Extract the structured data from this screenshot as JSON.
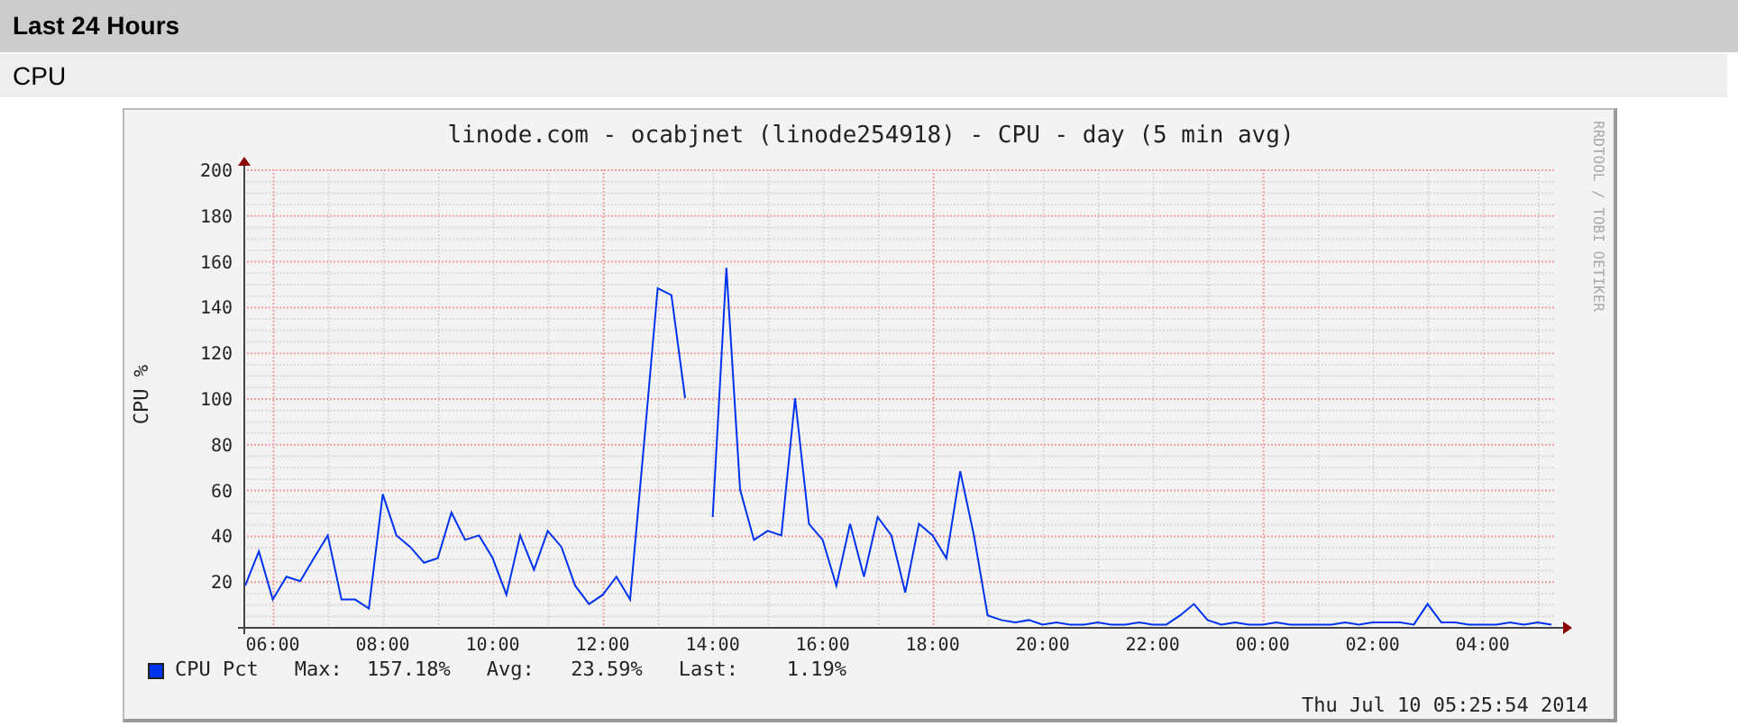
{
  "section": {
    "title": "Last 24 Hours"
  },
  "subsection": {
    "title": "CPU"
  },
  "graph": {
    "watermark": "RRDTOOL / TOBI OETIKER",
    "chart_data": {
      "type": "line",
      "title": "linode.com - ocabjnet (linode254918) - CPU - day (5 min avg)",
      "ylabel": "CPU %",
      "grid": true,
      "x": [
        "2014-07-09T05:30",
        "2014-07-09T05:45",
        "2014-07-09T06:00",
        "2014-07-09T06:15",
        "2014-07-09T06:30",
        "2014-07-09T06:45",
        "2014-07-09T07:00",
        "2014-07-09T07:15",
        "2014-07-09T07:30",
        "2014-07-09T07:45",
        "2014-07-09T08:00",
        "2014-07-09T08:15",
        "2014-07-09T08:30",
        "2014-07-09T08:45",
        "2014-07-09T09:00",
        "2014-07-09T09:15",
        "2014-07-09T09:30",
        "2014-07-09T09:45",
        "2014-07-09T10:00",
        "2014-07-09T10:15",
        "2014-07-09T10:30",
        "2014-07-09T10:45",
        "2014-07-09T11:00",
        "2014-07-09T11:15",
        "2014-07-09T11:30",
        "2014-07-09T11:45",
        "2014-07-09T12:00",
        "2014-07-09T12:15",
        "2014-07-09T12:30",
        "2014-07-09T12:45",
        "2014-07-09T13:00",
        "2014-07-09T13:15",
        "2014-07-09T13:30",
        "2014-07-09T14:00",
        "2014-07-09T14:15",
        "2014-07-09T14:30",
        "2014-07-09T14:45",
        "2014-07-09T15:00",
        "2014-07-09T15:15",
        "2014-07-09T15:30",
        "2014-07-09T15:45",
        "2014-07-09T16:00",
        "2014-07-09T16:15",
        "2014-07-09T16:30",
        "2014-07-09T16:45",
        "2014-07-09T17:00",
        "2014-07-09T17:15",
        "2014-07-09T17:30",
        "2014-07-09T17:45",
        "2014-07-09T18:00",
        "2014-07-09T18:15",
        "2014-07-09T18:30",
        "2014-07-09T18:45",
        "2014-07-09T19:00",
        "2014-07-09T19:15",
        "2014-07-09T19:30",
        "2014-07-09T19:45",
        "2014-07-09T20:00",
        "2014-07-09T20:15",
        "2014-07-09T20:30",
        "2014-07-09T20:45",
        "2014-07-09T21:00",
        "2014-07-09T21:15",
        "2014-07-09T21:30",
        "2014-07-09T21:45",
        "2014-07-09T22:00",
        "2014-07-09T22:15",
        "2014-07-09T22:30",
        "2014-07-09T22:45",
        "2014-07-09T23:00",
        "2014-07-09T23:15",
        "2014-07-09T23:30",
        "2014-07-09T23:45",
        "2014-07-10T00:00",
        "2014-07-10T00:15",
        "2014-07-10T00:30",
        "2014-07-10T00:45",
        "2014-07-10T01:00",
        "2014-07-10T01:15",
        "2014-07-10T01:30",
        "2014-07-10T01:45",
        "2014-07-10T02:00",
        "2014-07-10T02:15",
        "2014-07-10T02:30",
        "2014-07-10T02:45",
        "2014-07-10T03:00",
        "2014-07-10T03:15",
        "2014-07-10T03:30",
        "2014-07-10T03:45",
        "2014-07-10T04:00",
        "2014-07-10T04:15",
        "2014-07-10T04:30",
        "2014-07-10T04:45",
        "2014-07-10T05:00",
        "2014-07-10T05:15"
      ],
      "series": [
        {
          "name": "CPU Pct",
          "color": "#0033ee",
          "values": [
            18,
            33,
            12,
            22,
            20,
            30,
            40,
            12,
            12,
            8,
            58,
            40,
            35,
            28,
            30,
            50,
            38,
            40,
            30,
            14,
            40,
            25,
            42,
            35,
            18,
            10,
            14,
            22,
            12,
            80,
            148,
            145,
            100,
            48,
            157,
            60,
            38,
            42,
            40,
            100,
            45,
            38,
            18,
            45,
            22,
            48,
            40,
            15,
            45,
            40,
            30,
            68,
            40,
            5,
            3,
            2,
            3,
            1,
            2,
            1,
            1,
            2,
            1,
            1,
            2,
            1,
            1,
            5,
            10,
            3,
            1,
            2,
            1,
            1,
            2,
            1,
            1,
            1,
            1,
            2,
            1,
            2,
            2,
            2,
            1,
            10,
            2,
            2,
            1,
            1,
            1,
            2,
            1,
            2,
            1
          ]
        }
      ],
      "xlim": [
        "2014-07-09T05:28",
        "2014-07-10T05:20"
      ],
      "ylim": [
        0,
        200
      ],
      "xticks": [
        {
          "value": "2014-07-09T06:00",
          "label": "06:00"
        },
        {
          "value": "2014-07-09T08:00",
          "label": "08:00"
        },
        {
          "value": "2014-07-09T10:00",
          "label": "10:00"
        },
        {
          "value": "2014-07-09T12:00",
          "label": "12:00"
        },
        {
          "value": "2014-07-09T14:00",
          "label": "14:00"
        },
        {
          "value": "2014-07-09T16:00",
          "label": "16:00"
        },
        {
          "value": "2014-07-09T18:00",
          "label": "18:00"
        },
        {
          "value": "2014-07-09T20:00",
          "label": "20:00"
        },
        {
          "value": "2014-07-09T22:00",
          "label": "22:00"
        },
        {
          "value": "2014-07-10T00:00",
          "label": "00:00"
        },
        {
          "value": "2014-07-10T02:00",
          "label": "02:00"
        },
        {
          "value": "2014-07-10T04:00",
          "label": "04:00"
        }
      ],
      "yticks": [
        20,
        40,
        60,
        80,
        100,
        120,
        140,
        160,
        180,
        200
      ]
    },
    "stats": [
      {
        "label": "Max:",
        "value": "157.18%"
      },
      {
        "label": "Avg:",
        "value": "23.59%"
      },
      {
        "label": "Last:",
        "value": "1.19%"
      }
    ],
    "timestamp": "Thu Jul 10 05:25:54 2014"
  }
}
